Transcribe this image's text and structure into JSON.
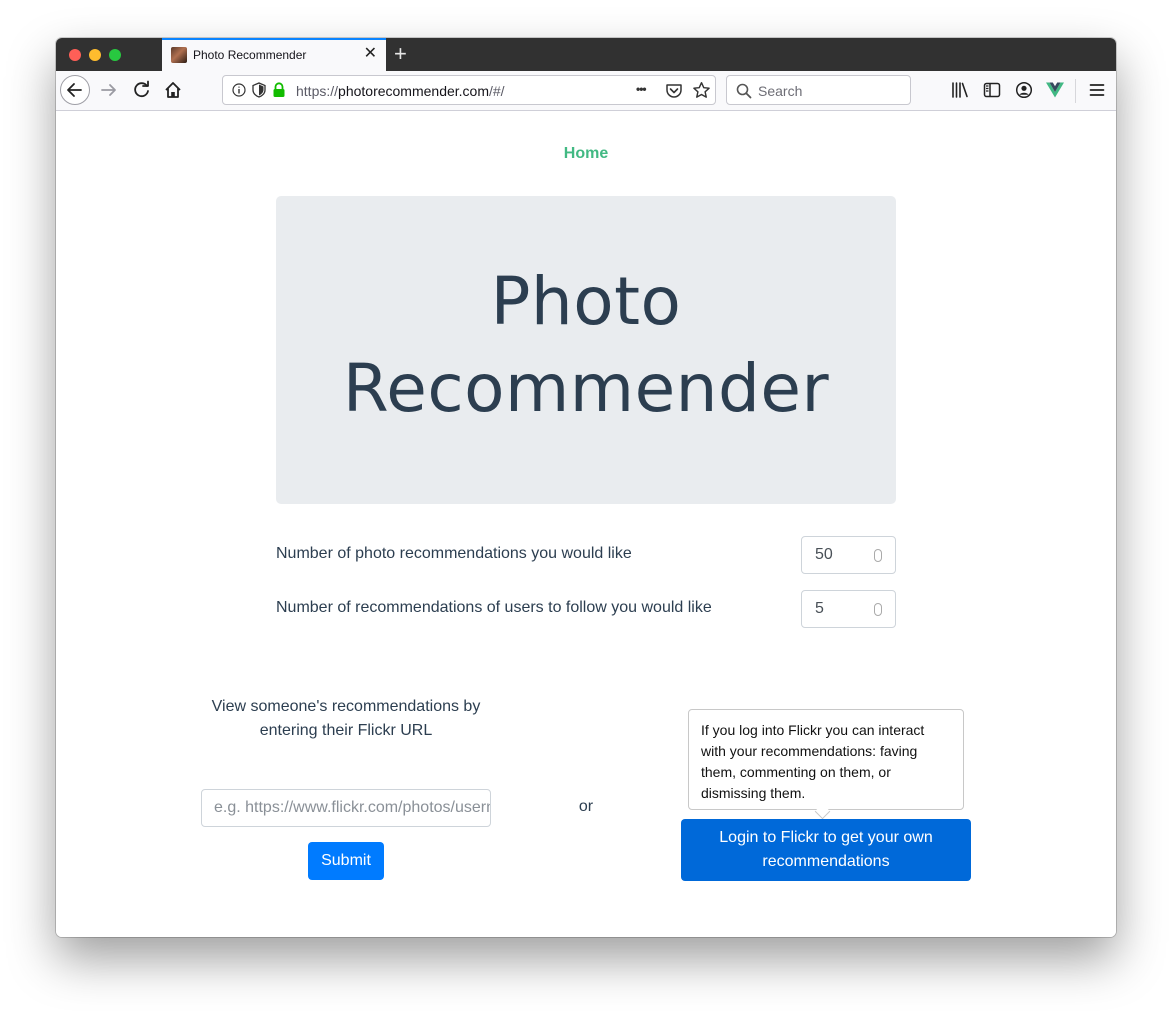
{
  "browser": {
    "tab_title": "Photo Recommender",
    "tab_close": "✕",
    "new_tab": "+",
    "url_prefix": "https://",
    "url_host": "photorecommender.com",
    "url_path": "/#/",
    "search_placeholder": "Search",
    "more_glyph": "•••"
  },
  "nav": {
    "home_label": "Home"
  },
  "hero": {
    "title_line1": "Photo",
    "title_line2": "Recommender"
  },
  "settings": {
    "photo_recs_label": "Number of photo recommendations you would like",
    "photo_recs_value": "50",
    "user_recs_label": "Number of recommendations of users to follow you would like",
    "user_recs_value": "5"
  },
  "lookup": {
    "label": "View someone's recommendations by entering their Flickr URL",
    "placeholder": "e.g. https://www.flickr.com/photos/username",
    "submit_label": "Submit"
  },
  "or_label": "or",
  "login": {
    "tooltip": "If you log into Flickr you can interact with your recommendations: faving them, commenting on them, or dismissing them.",
    "button_label": "Login to Flickr to get your own recommendations"
  },
  "colors": {
    "home_link": "#42b983",
    "heading": "#2c3e50",
    "jumbotron_bg": "#e9ecef",
    "submit_bg": "#007bff",
    "login_bg": "#0069d9"
  }
}
